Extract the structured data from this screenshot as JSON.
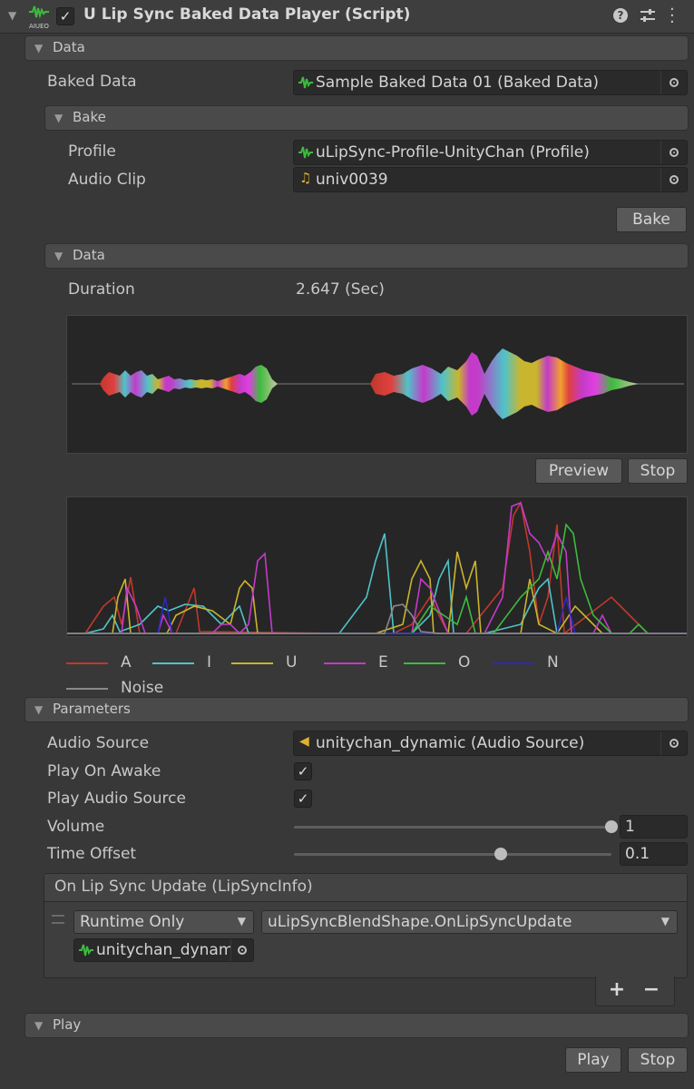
{
  "header": {
    "icon": "aiueo-waveform-icon",
    "enabled": true,
    "title": "U Lip Sync Baked Data Player (Script)",
    "icon_caption": "AIUEO",
    "help_icon": "help-icon",
    "presets_icon": "sliders-icon",
    "menu_icon": "kebab-menu-icon"
  },
  "data_section": {
    "title": "Data",
    "baked_data_label": "Baked Data",
    "baked_data_value": "Sample Baked Data 01 (Baked Data)"
  },
  "bake_section": {
    "title": "Bake",
    "profile_label": "Profile",
    "profile_value": "uLipSync-Profile-UnityChan (Profile)",
    "audio_clip_label": "Audio Clip",
    "audio_clip_value": "univ0039",
    "bake_button": "Bake"
  },
  "data_sub": {
    "title": "Data",
    "duration_label": "Duration",
    "duration_value": "2.647 (Sec)",
    "preview_button": "Preview",
    "stop_button": "Stop"
  },
  "legend": [
    {
      "name": "A",
      "color": "#c0392b"
    },
    {
      "name": "I",
      "color": "#4fc3c9"
    },
    {
      "name": "U",
      "color": "#c9b52e"
    },
    {
      "name": "E",
      "color": "#c43ac9"
    },
    {
      "name": "O",
      "color": "#3dbb3d"
    },
    {
      "name": "N",
      "color": "#2a2ac0"
    },
    {
      "name": "Noise",
      "color": "#8a8a8a"
    }
  ],
  "parameters": {
    "title": "Parameters",
    "audio_source_label": "Audio Source",
    "audio_source_value": "unitychan_dynamic (Audio Source)",
    "play_on_awake_label": "Play On Awake",
    "play_on_awake": true,
    "play_audio_source_label": "Play Audio Source",
    "play_audio_source": true,
    "volume_label": "Volume",
    "volume_value": "1",
    "volume_fraction": 1.0,
    "time_offset_label": "Time Offset",
    "time_offset_value": "0.1",
    "time_offset_fraction": 0.65
  },
  "event": {
    "title": "On Lip Sync Update (LipSyncInfo)",
    "runtime_option": "Runtime Only",
    "function": "uLipSyncBlendShape.OnLipSyncUpdate",
    "target": "unitychan_dynam",
    "add_button": "+",
    "remove_button": "−"
  },
  "play_section": {
    "title": "Play",
    "play_button": "Play",
    "stop_button": "Stop"
  }
}
